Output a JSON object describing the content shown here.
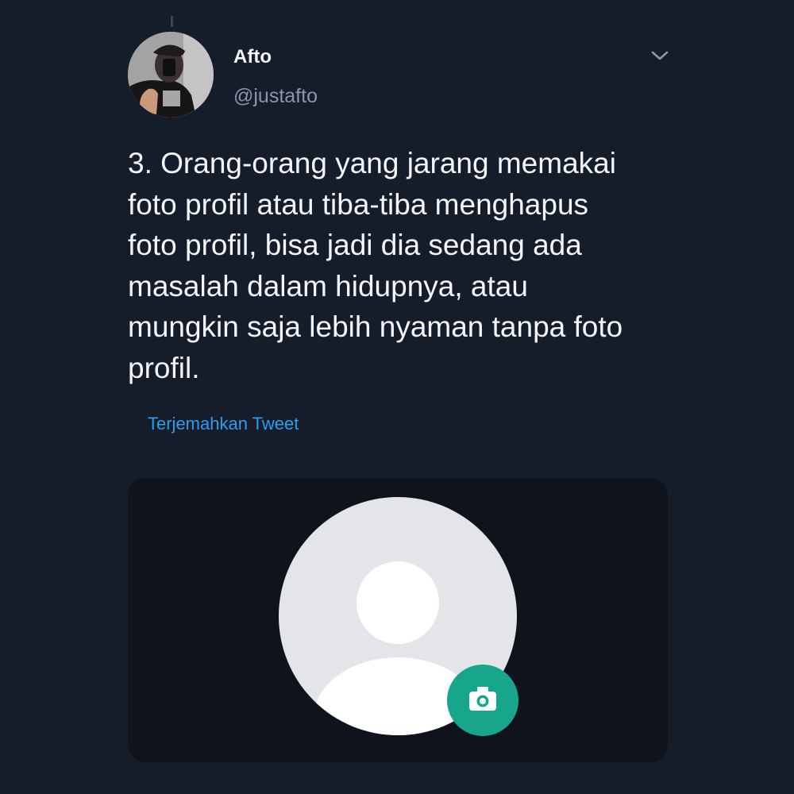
{
  "tweet": {
    "author_name": "Afto",
    "author_handle": "@justafto",
    "text": "3.  Orang-orang yang jarang memakai\nfoto profil atau tiba-tiba menghapus\nfoto profil, bisa jadi dia sedang ada\nmasalah dalam hidupnya, atau\nmungkin saja lebih nyaman tanpa foto\nprofil.",
    "translate_label": "Terjemahkan Tweet",
    "menu_icon": "chevron-down-icon",
    "camera_icon": "camera-icon"
  },
  "colors": {
    "background": "#161d2a",
    "text": "#f2f4f7",
    "secondary_text": "#8a97a6",
    "link": "#2b9df0",
    "media_background": "#0e131c",
    "placeholder_circle": "#e3e5e8",
    "camera_badge": "#17a58b"
  }
}
